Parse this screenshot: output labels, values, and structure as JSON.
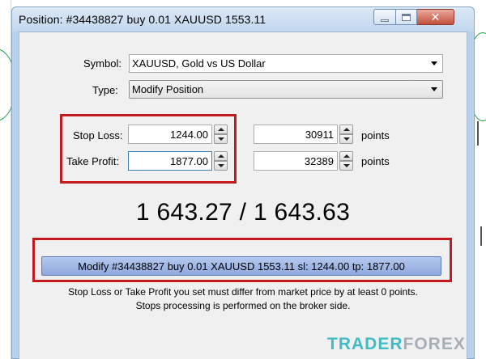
{
  "window": {
    "title": "Position: #34438827 buy 0.01 XAUUSD 1553.11"
  },
  "form": {
    "symbol_label": "Symbol:",
    "symbol_value": "XAUUSD, Gold vs US Dollar",
    "type_label": "Type:",
    "type_value": "Modify Position",
    "stop_loss_label": "Stop Loss:",
    "stop_loss_value": "1244.00",
    "stop_loss_points": "30911",
    "take_profit_label": "Take Profit:",
    "take_profit_value": "1877.00",
    "take_profit_points": "32389",
    "points_label": "points"
  },
  "quote": {
    "bid_ask": "1 643.27 / 1 643.63"
  },
  "modify_button": {
    "label": "Modify #34438827 buy 0.01 XAUUSD 1553.11 sl: 1244.00 tp: 1877.00"
  },
  "notes": {
    "line1": "Stop Loss or Take Profit you set must differ from market price by at least 0 points.",
    "line2": "Stops processing is performed on the broker side."
  },
  "watermark": {
    "part1": "TRADER",
    "part2": "FOREX"
  },
  "colors": {
    "highlight_box": "#c4191f",
    "button_fill": "#9fb6e5",
    "dialog_bg": "#f0f0f0",
    "frame": "#b9d1ea"
  }
}
